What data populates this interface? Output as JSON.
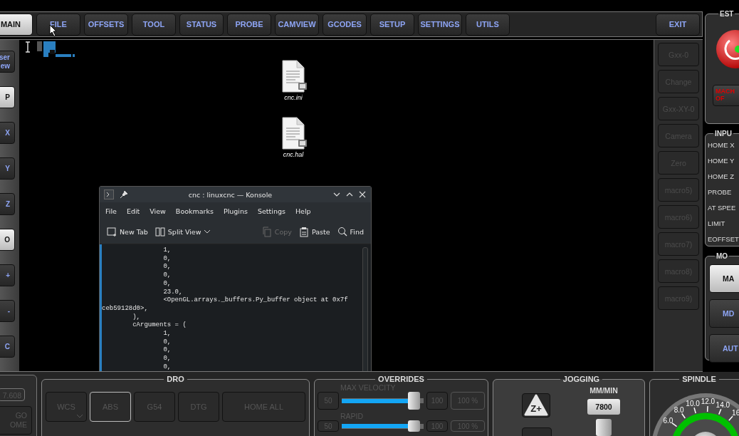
{
  "tabs": [
    {
      "label": "MAIN",
      "selected": true
    },
    {
      "label": "FILE",
      "selected": false
    },
    {
      "label": "OFFSETS",
      "selected": false
    },
    {
      "label": "TOOL",
      "selected": false
    },
    {
      "label": "STATUS",
      "selected": false
    },
    {
      "label": "PROBE",
      "selected": false
    },
    {
      "label": "CAMVIEW",
      "selected": false
    },
    {
      "label": "GCODES",
      "selected": false
    },
    {
      "label": "SETUP",
      "selected": false
    },
    {
      "label": "SETTINGS",
      "selected": false
    },
    {
      "label": "UTILS",
      "selected": false
    }
  ],
  "exit_button": "EXIT",
  "side_buttons": [
    {
      "label": "ser\new",
      "selected": false
    },
    {
      "label": "P",
      "selected": true
    },
    {
      "label": "X",
      "selected": false
    },
    {
      "label": "Y",
      "selected": false
    },
    {
      "label": "Z",
      "selected": false
    },
    {
      "label": "O",
      "selected": true
    },
    {
      "label": "+",
      "selected": false
    },
    {
      "label": "-",
      "selected": false
    },
    {
      "label": "C",
      "selected": false
    }
  ],
  "desktop_files": [
    {
      "name": "cnc.ini"
    },
    {
      "name": "cnc.hal"
    }
  ],
  "konsole": {
    "title": "cnc : linuxcnc — Konsole",
    "menu": [
      "File",
      "Edit",
      "View",
      "Bookmarks",
      "Plugins",
      "Settings",
      "Help"
    ],
    "toolbar": [
      {
        "label": "New Tab",
        "disabled": false
      },
      {
        "label": "Split View",
        "disabled": false
      },
      {
        "label": "Copy",
        "disabled": true
      },
      {
        "label": "Paste",
        "disabled": false
      },
      {
        "label": "Find",
        "disabled": false
      }
    ],
    "lines": [
      "                1,",
      "                0,",
      "                0,",
      "                0,",
      "                0,",
      "                23.0,",
      "                <OpenGL.arrays._buffers.Py_buffer object at 0x7f",
      "ceb59128d0>,",
      "        ),",
      "        cArguments = (",
      "                1,",
      "                0,",
      "                0,",
      "                0,",
      "                0,"
    ]
  },
  "macros": [
    {
      "label": "Gxx-0",
      "disabled": true
    },
    {
      "label": "Change",
      "disabled": true
    },
    {
      "label": "Gxx-XY-0",
      "disabled": true
    },
    {
      "label": "Camera",
      "disabled": true
    },
    {
      "label": "Zero",
      "disabled": true
    },
    {
      "label": "macro5)",
      "disabled": true
    },
    {
      "label": "macro6)",
      "disabled": true
    },
    {
      "label": "macro7)",
      "disabled": true
    },
    {
      "label": "macro8)",
      "disabled": true
    },
    {
      "label": "macro9)",
      "disabled": true
    }
  ],
  "estop": {
    "title": "EST",
    "machine_button": "MACH\nOF"
  },
  "inputs": {
    "title": "INPU",
    "items": [
      "HOME X",
      "HOME Y",
      "HOME Z",
      "PROBE",
      "AT SPEE",
      "LIMIT",
      "EOFFSET"
    ]
  },
  "mode": {
    "title": "MO",
    "buttons": [
      {
        "label": "MA",
        "selected": true
      },
      {
        "label": "MD",
        "selected": false
      },
      {
        "label": "AUT",
        "selected": false
      }
    ]
  },
  "left_panel": {
    "value": "7.608",
    "button": "GO\nOME"
  },
  "dro": {
    "title": "DRO",
    "buttons": [
      {
        "label": "WCS",
        "kind": "dropdown",
        "selected": false,
        "disabled": true
      },
      {
        "label": "ABS",
        "kind": "button",
        "selected": true,
        "disabled": true
      },
      {
        "label": "G54",
        "kind": "button",
        "selected": false,
        "disabled": true
      },
      {
        "label": "DTG",
        "kind": "button",
        "selected": false,
        "disabled": true
      },
      {
        "label": "HOME ALL",
        "kind": "button",
        "selected": false,
        "disabled": true
      }
    ]
  },
  "overrides": {
    "title": "OVERRIDES",
    "rows": [
      {
        "label": "MAX VELOCITY",
        "min": "50",
        "level": 0.95,
        "max": "100",
        "value": "100 %"
      },
      {
        "label": "RAPID",
        "min": "50",
        "level": 0.95,
        "max": "100",
        "value": "100 %"
      }
    ]
  },
  "jogging": {
    "title": "JOGGING",
    "jog_button": "Z+",
    "units": "MM/MIN",
    "rate": "7800"
  },
  "spindle": {
    "title": "SPINDLE",
    "scale": [
      "6.0",
      "8.0",
      "10.0",
      "12.0",
      "14.0",
      "16"
    ]
  }
}
